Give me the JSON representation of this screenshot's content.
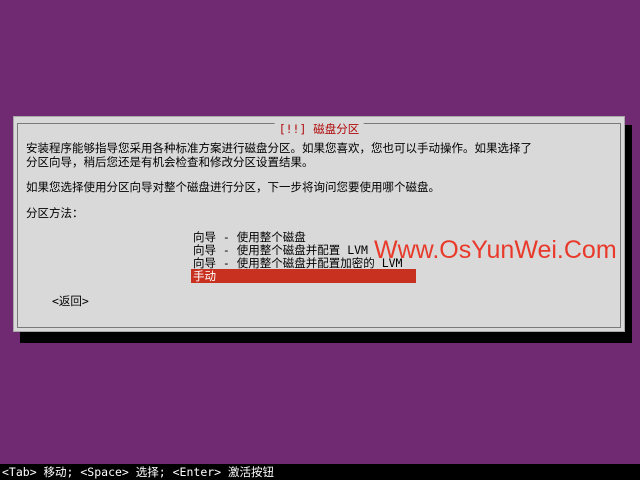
{
  "dialog": {
    "title": "[!!] 磁盘分区",
    "description_lines": [
      "安装程序能够指导您采用各种标准方案进行磁盘分区。如果您喜欢，您也可以手动操作。如果选择了",
      "分区向导，稍后您还是有机会检查和修改分区设置结果。"
    ],
    "question": "如果您选择使用分区向导对整个磁盘进行分区，下一步将询问您要使用哪个磁盘。",
    "method_label": "分区方法：",
    "options": [
      {
        "label": "向导 - 使用整个磁盘",
        "selected": false
      },
      {
        "label": "向导 - 使用整个磁盘并配置 LVM",
        "selected": false
      },
      {
        "label": "向导 - 使用整个磁盘并配置加密的 LVM",
        "selected": false
      },
      {
        "label": "手动",
        "selected": true
      }
    ],
    "back_label": "<返回>"
  },
  "watermark": "Www.OsYunWei.Com",
  "status_bar": "<Tab> 移动; <Space> 选择; <Enter> 激活按钮",
  "colors": {
    "background": "#6f2a72",
    "dialog": "#d9d9d9",
    "title": "#b00a0a",
    "selection": "#c8301f",
    "watermark": "#e8392a"
  }
}
